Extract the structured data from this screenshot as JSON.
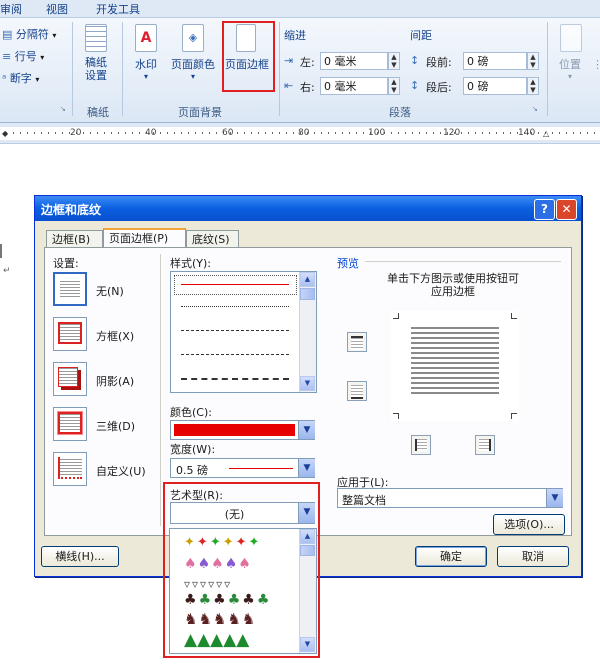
{
  "ribbon": {
    "tabs": [
      "审阅",
      "视图",
      "开发工具"
    ],
    "left_items": [
      "分隔符",
      "行号",
      "断字"
    ],
    "paper_setup": {
      "label": "稿纸\n设置",
      "group": "稿纸"
    },
    "page_bg": {
      "watermark": "水印",
      "page_color": "页面颜色",
      "page_border": "页面边框",
      "group": "页面背景"
    },
    "indent": {
      "title": "缩进",
      "left_label": "左:",
      "left_value": "0 毫米",
      "right_label": "右:",
      "right_value": "0 毫米"
    },
    "spacing": {
      "title": "间距",
      "before_label": "段前:",
      "before_value": "0 磅",
      "after_label": "段后:",
      "after_value": "0 磅"
    },
    "paragraph_group": "段落",
    "position": "位置"
  },
  "ruler": {
    "marks": [
      "20",
      "40",
      "60",
      "80",
      "100",
      "120",
      "140"
    ]
  },
  "dialog": {
    "title": "边框和底纹",
    "help": "?",
    "close": "✕",
    "tabs": [
      "边框(B)",
      "页面边框(P)",
      "底纹(S)"
    ],
    "settings": {
      "label": "设置:",
      "items": [
        "无(N)",
        "方框(X)",
        "阴影(A)",
        "三维(D)",
        "自定义(U)"
      ]
    },
    "style": {
      "label": "样式(Y):"
    },
    "color": {
      "label": "颜色(C):",
      "value": "#e60000"
    },
    "width": {
      "label": "宽度(W):",
      "value": "0.5 磅"
    },
    "art": {
      "label": "艺术型(R):",
      "value": "(无)"
    },
    "preview": {
      "label": "预览",
      "hint": "单击下方图示或使用按钮可\n应用边框"
    },
    "apply_to": {
      "label": "应用于(L):",
      "value": "整篇文档"
    },
    "options_button": "选项(O)...",
    "hline_button": "横线(H)...",
    "ok_button": "确定",
    "cancel_button": "取消"
  }
}
